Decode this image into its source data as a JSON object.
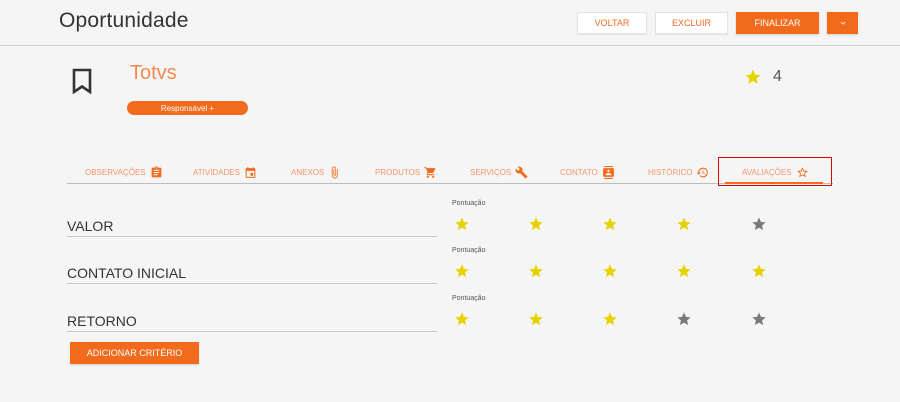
{
  "header": {
    "title": "Oportunidade",
    "buttons": {
      "back": "VOLTAR",
      "delete": "EXCLUIR",
      "finish": "FINALIZAR"
    }
  },
  "opportunity": {
    "name": "Totvs",
    "responsible_label": "Responsável +",
    "score": "4"
  },
  "tabs": [
    {
      "label": "OBSERVAÇÕES",
      "icon": "clipboard-icon"
    },
    {
      "label": "ATIVIDADES",
      "icon": "calendar-icon"
    },
    {
      "label": "ANEXOS",
      "icon": "paperclip-icon"
    },
    {
      "label": "PRODUTOS",
      "icon": "cart-icon"
    },
    {
      "label": "SERVIÇOS",
      "icon": "wrench-icon"
    },
    {
      "label": "CONTATO",
      "icon": "contact-card-icon"
    },
    {
      "label": "HISTÓRICO",
      "icon": "history-icon"
    },
    {
      "label": "AVALIAÇÕES",
      "icon": "star-outline-icon",
      "active": true
    }
  ],
  "criteria": [
    {
      "name": "VALOR",
      "score_label": "Pontuação",
      "rating": 4,
      "max": 5
    },
    {
      "name": "CONTATO INICIAL",
      "score_label": "Pontuação",
      "rating": 5,
      "max": 5
    },
    {
      "name": "RETORNO",
      "score_label": "Pontuação",
      "rating": 3,
      "max": 5
    }
  ],
  "add_criterion_label": "ADICIONAR CRITÉRIO",
  "colors": {
    "accent": "#f26b1d",
    "star_filled": "#e5d300",
    "star_empty": "#7a7a7a",
    "highlight_box": "#e00000"
  }
}
